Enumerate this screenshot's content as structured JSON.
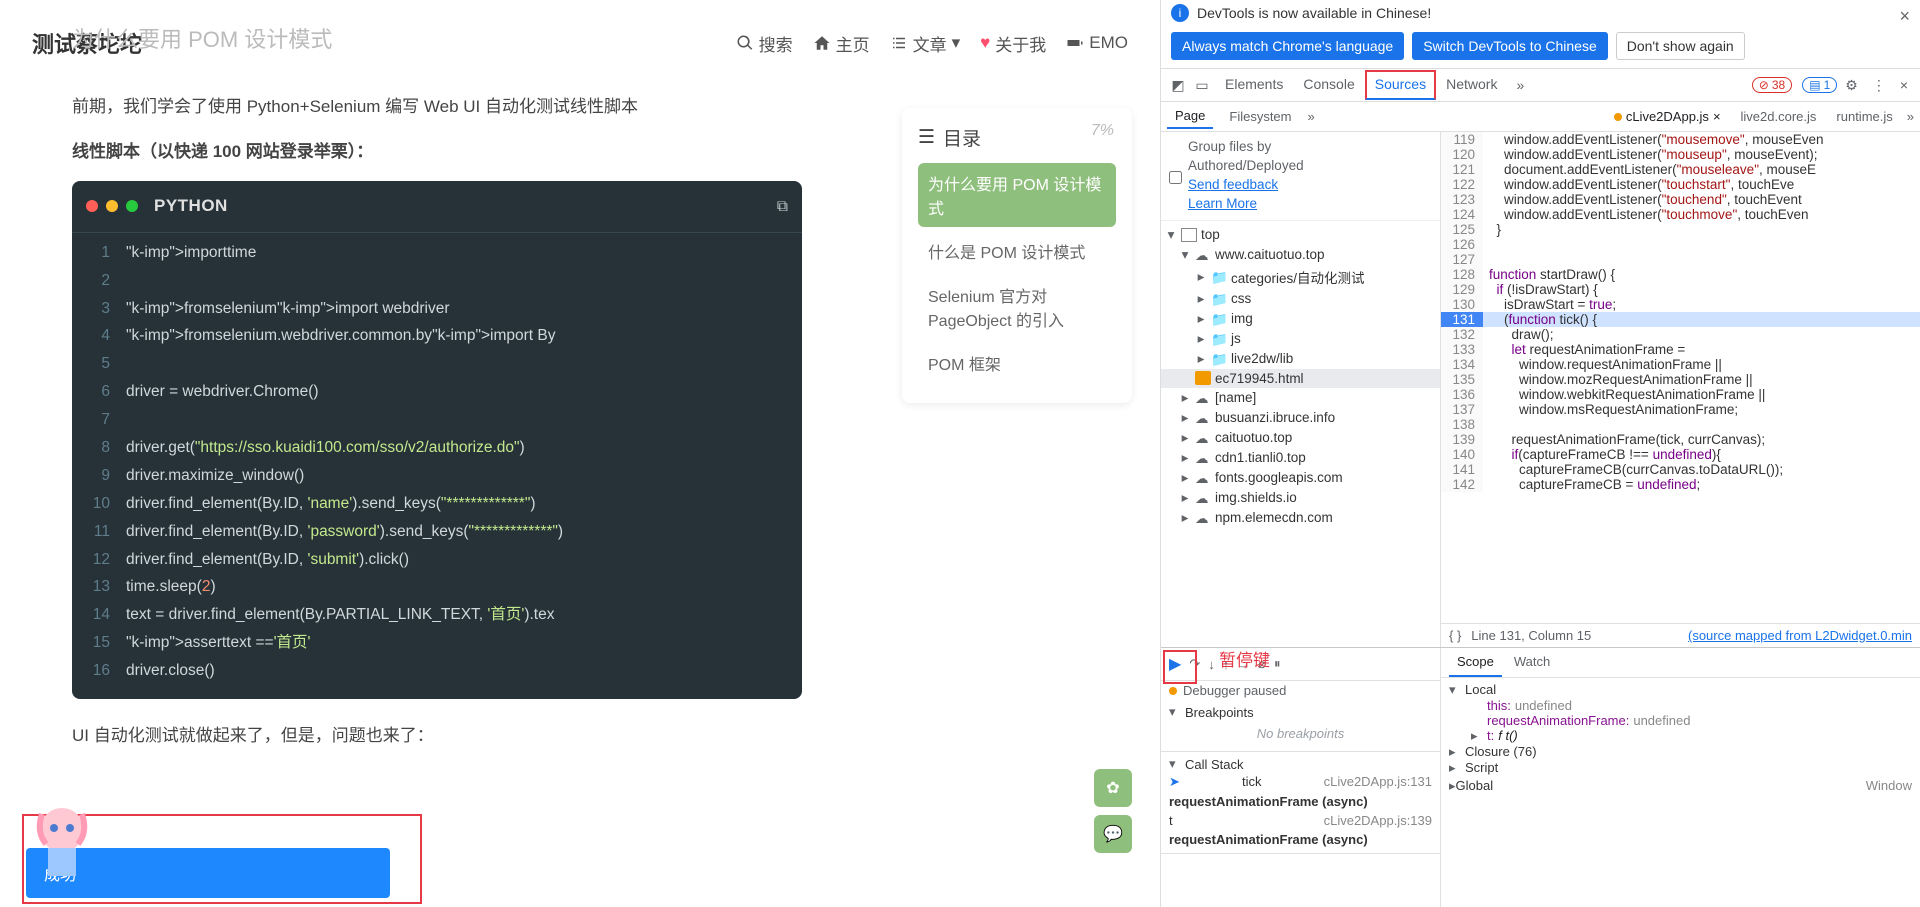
{
  "blog": {
    "site_title": "测试蔡坨坨",
    "ghost_heading": "为什么要用 POM 设计模式",
    "nav": {
      "search": "搜索",
      "home": "主页",
      "posts": "文章",
      "about": "关于我",
      "emo": "EMO"
    },
    "intro": "前期，我们学会了使用 Python+Selenium 编写 Web UI 自动化测试线性脚本",
    "linear_heading": "线性脚本（以快递 100 网站登录举栗）：",
    "code_lang": "PYTHON",
    "code_lines": [
      "import time",
      "",
      "from selenium import webdriver",
      "from selenium.webdriver.common.by import By",
      "",
      "driver = webdriver.Chrome()",
      "",
      "driver.get(\"https://sso.kuaidi100.com/sso/v2/authorize.do\")",
      "driver.maximize_window()",
      "driver.find_element(By.ID, 'name').send_keys(\"*************\")",
      "driver.find_element(By.ID, 'password').send_keys(\"*************\")",
      "driver.find_element(By.ID, 'submit').click()",
      "time.sleep(2)",
      "text = driver.find_element(By.PARTIAL_LINK_TEXT, '首页').tex",
      "assert text == '首页'",
      "driver.close()"
    ],
    "after_text": "UI 自动化测试就做起来了，但是，问题也来了：",
    "toast": "成功",
    "toc": {
      "label": "目录",
      "pct": "7%",
      "items": [
        "为什么要用 POM 设计模式",
        "什么是 POM 设计模式",
        "Selenium 官方对 PageObject 的引入",
        "POM 框架"
      ],
      "active_index": 0
    }
  },
  "devtools": {
    "info": "DevTools is now available in Chinese!",
    "lang_buttons": {
      "match": "Always match Chrome's language",
      "switch": "Switch DevTools to Chinese",
      "dont": "Don't show again"
    },
    "tabs": [
      "Elements",
      "Console",
      "Sources",
      "Network"
    ],
    "active_tab_index": 2,
    "errors": "38",
    "issues": "1",
    "sub_left": [
      "Page",
      "Filesystem"
    ],
    "open_files": [
      {
        "name": "cLive2DApp.js",
        "current": true
      },
      {
        "name": "live2d.core.js",
        "current": false
      },
      {
        "name": "runtime.js",
        "current": false
      }
    ],
    "group_hint": {
      "l1": "Group files by",
      "l2": "Authored/Deployed",
      "feedback": "Send feedback",
      "learn": "Learn More"
    },
    "tree": [
      {
        "t": "frame",
        "lbl": "top",
        "d": 0,
        "open": true
      },
      {
        "t": "cloud",
        "lbl": "www.caituotuo.top",
        "d": 1,
        "open": true
      },
      {
        "t": "folder",
        "lbl": "categories/自动化测试",
        "d": 2
      },
      {
        "t": "folder",
        "lbl": "css",
        "d": 2
      },
      {
        "t": "folder",
        "lbl": "img",
        "d": 2
      },
      {
        "t": "folder",
        "lbl": "js",
        "d": 2
      },
      {
        "t": "folder",
        "lbl": "live2dw/lib",
        "d": 2
      },
      {
        "t": "file",
        "lbl": "ec719945.html",
        "d": 2,
        "sel": true
      },
      {
        "t": "cloud",
        "lbl": "[name]",
        "d": 1
      },
      {
        "t": "cloud",
        "lbl": "busuanzi.ibruce.info",
        "d": 1
      },
      {
        "t": "cloud",
        "lbl": "caituotuo.top",
        "d": 1
      },
      {
        "t": "cloud",
        "lbl": "cdn1.tianli0.top",
        "d": 1
      },
      {
        "t": "cloud",
        "lbl": "fonts.googleapis.com",
        "d": 1
      },
      {
        "t": "cloud",
        "lbl": "img.shields.io",
        "d": 1
      },
      {
        "t": "cloud",
        "lbl": "npm.elemecdn.com",
        "d": 1
      }
    ],
    "code": [
      {
        "n": 119,
        "t": "    window.addEventListener(\"mousemove\", mouseEven"
      },
      {
        "n": 120,
        "t": "    window.addEventListener(\"mouseup\", mouseEvent);"
      },
      {
        "n": 121,
        "t": "    document.addEventListener(\"mouseleave\", mouseE"
      },
      {
        "n": 122,
        "t": "    window.addEventListener(\"touchstart\", touchEve"
      },
      {
        "n": 123,
        "t": "    window.addEventListener(\"touchend\", touchEvent"
      },
      {
        "n": 124,
        "t": "    window.addEventListener(\"touchmove\", touchEven"
      },
      {
        "n": 125,
        "t": "  }"
      },
      {
        "n": 126,
        "t": ""
      },
      {
        "n": 127,
        "t": ""
      },
      {
        "n": 128,
        "t": "function startDraw() {"
      },
      {
        "n": 129,
        "t": "  if (!isDrawStart) {"
      },
      {
        "n": 130,
        "t": "    isDrawStart = true;"
      },
      {
        "n": 131,
        "t": "    (function tick() {",
        "hl": true
      },
      {
        "n": 132,
        "t": "      draw();"
      },
      {
        "n": 133,
        "t": "      let requestAnimationFrame ="
      },
      {
        "n": 134,
        "t": "        window.requestAnimationFrame ||"
      },
      {
        "n": 135,
        "t": "        window.mozRequestAnimationFrame ||"
      },
      {
        "n": 136,
        "t": "        window.webkitRequestAnimationFrame ||"
      },
      {
        "n": 137,
        "t": "        window.msRequestAnimationFrame;"
      },
      {
        "n": 138,
        "t": ""
      },
      {
        "n": 139,
        "t": "      requestAnimationFrame(tick, currCanvas);"
      },
      {
        "n": 140,
        "t": "      if(captureFrameCB !== undefined){"
      },
      {
        "n": 141,
        "t": "        captureFrameCB(currCanvas.toDataURL());"
      },
      {
        "n": 142,
        "t": "        captureFrameCB = undefined;"
      }
    ],
    "status": {
      "pos": "Line 131, Column 15",
      "mapped": "(source mapped from L2Dwidget.0.min"
    },
    "pause_label": "暂停键",
    "debugger_paused": "Debugger paused",
    "sections": {
      "breakpoints": "Breakpoints",
      "no_bp": "No breakpoints",
      "callstack": "Call Stack"
    },
    "stack": [
      {
        "fn": "tick",
        "loc": "cLive2DApp.js:131",
        "cur": true
      },
      {
        "fn": "requestAnimationFrame (async)",
        "async": true
      },
      {
        "fn": "t",
        "loc": "cLive2DApp.js:139"
      },
      {
        "fn": "requestAnimationFrame (async)",
        "async": true
      }
    ],
    "scope": {
      "tabs": [
        "Scope",
        "Watch"
      ],
      "local": "Local",
      "rows": [
        {
          "k": "this:",
          "v": "undefined",
          "u": true
        },
        {
          "k": "requestAnimationFrame:",
          "v": "undefined",
          "u": true
        },
        {
          "k": "t:",
          "v": "f t()",
          "fn": true
        }
      ],
      "closure": "Closure (76)",
      "script": "Script",
      "global": "Global",
      "window": "Window"
    }
  }
}
